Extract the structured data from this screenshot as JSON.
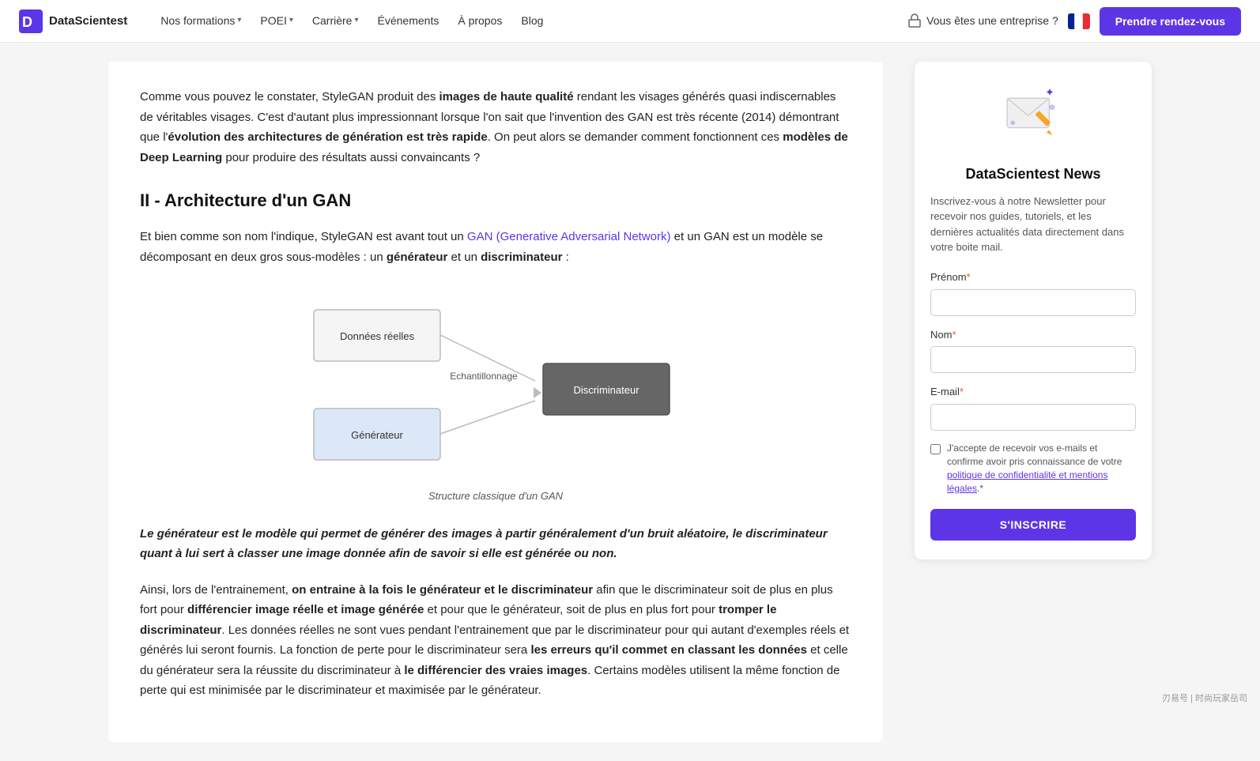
{
  "nav": {
    "logo_text": "DataScientest",
    "links": [
      {
        "label": "Nos formations",
        "has_dropdown": true
      },
      {
        "label": "POEI",
        "has_dropdown": true
      },
      {
        "label": "Carrière",
        "has_dropdown": true
      },
      {
        "label": "Événements",
        "has_dropdown": false
      },
      {
        "label": "À propos",
        "has_dropdown": false
      },
      {
        "label": "Blog",
        "has_dropdown": false
      }
    ],
    "enterprise_label": "Vous êtes une entreprise ?",
    "cta_label": "Prendre rendez-vous"
  },
  "article": {
    "intro_para": "Comme vous pouvez le constater, StyleGAN produit des ",
    "intro_bold1": "images de haute qualité",
    "intro_mid1": " rendant les visages générés quasi indiscernables de véritables visages. C'est d'autant plus impressionnant lorsque l'on sait que l'invention des GAN est très récente (2014) démontrant que l'",
    "intro_bold2": "évolution des architectures de génération est très rapide",
    "intro_end": ". On peut alors se demander comment fonctionnent ces ",
    "intro_bold3": "modèles de Deep Learning",
    "intro_end2": " pour produire des résultats aussi convaincants ?",
    "section_title": "II - Architecture d'un GAN",
    "section_intro": "Et bien comme son nom l'indique, StyleGAN est avant tout un ",
    "gan_link": "GAN (Generative Adversarial Network)",
    "section_intro2": " et un GAN est un modèle se décomposant en deux gros sous-modèles : un ",
    "generateur": "générateur",
    "section_intro3": " et un ",
    "discriminateur": "discriminateur",
    "section_intro4": " :",
    "diagram_caption": "Structure classique d'un GAN",
    "diagram": {
      "donnees_label": "Données réelles",
      "generateur_label": "Générateur",
      "echantillonnage_label": "Echantillonnage",
      "discriminateur_label": "Discriminateur"
    },
    "highlight_para": "Le générateur est le modèle qui permet de générer des images à partir généralement d'un bruit aléatoire, le discriminateur quant à lui sert à classer une image donnée afin de savoir si elle est générée ou non.",
    "bottom_para_start": "Ainsi, lors de l'entrainement, ",
    "bottom_bold1": "on entraine à la fois le générateur et le discriminateur",
    "bottom_mid1": " afin que le discriminateur soit de plus en plus fort pour ",
    "bottom_bold2": "différencier image réelle et image générée",
    "bottom_mid2": " et pour que le générateur, soit de plus en plus fort pour ",
    "bottom_bold3": "tromper le discriminateur",
    "bottom_mid3": ". Les données réelles ne sont vues pendant l'entrainement que par le discriminateur pour qui autant d'exemples réels et générés lui seront fournis. La fonction de perte pour le discriminateur sera ",
    "bottom_bold4": "les erreurs qu'il commet en classant les données",
    "bottom_mid4": " et celle du générateur sera la réussite du discriminateur à ",
    "bottom_bold5": "le différencier des vraies images",
    "bottom_end": ". Certains modèles utilisent la même fonction de perte qui est minimisée par le discriminateur et maximisée par le générateur."
  },
  "sidebar": {
    "newsletter_title": "DataScientest News",
    "newsletter_desc": "Inscrivez-vous à notre Newsletter pour recevoir nos guides, tutoriels, et les dernières actualités data directement dans votre boite mail.",
    "prenom_label": "Prénom",
    "nom_label": "Nom",
    "email_label": "E-mail",
    "required_marker": "*",
    "checkbox_text": "J'accepte de recevoir vos e-mails et confirme avoir pris connaissance de votre politique de confidentialité et mentions légales.",
    "subscribe_btn": "S'INSCRIRE"
  },
  "watermark": "刃易号 | 时尚玩家岳司"
}
